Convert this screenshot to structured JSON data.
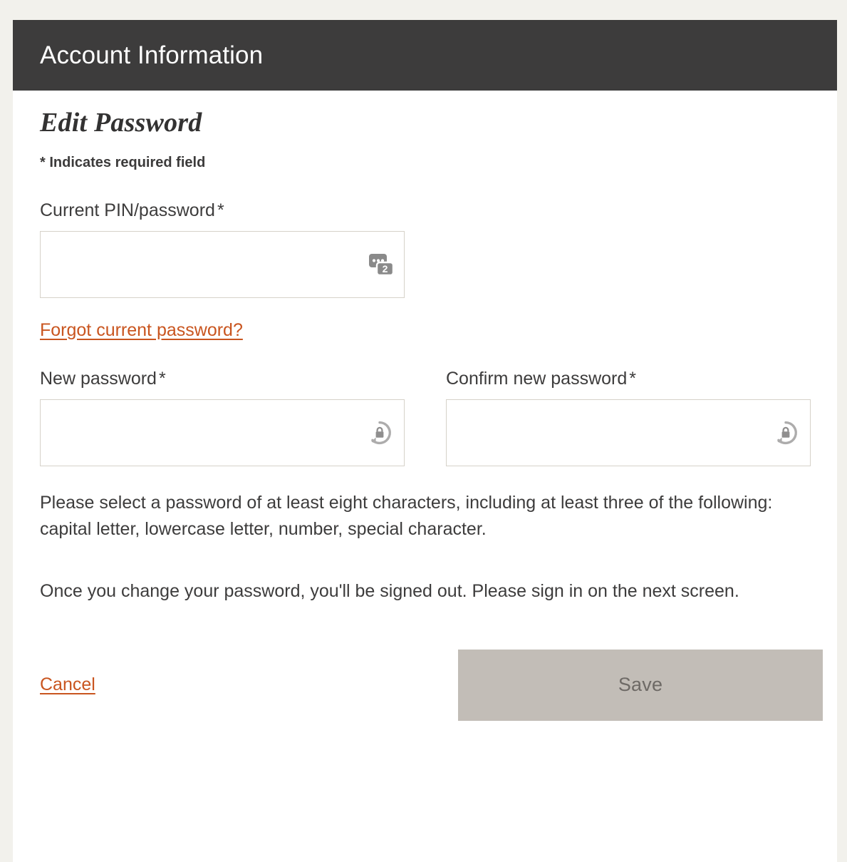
{
  "header": {
    "title": "Account Information"
  },
  "form": {
    "heading": "Edit Password",
    "required_note": "* Indicates required field",
    "required_marker": "*",
    "current_password": {
      "label": "Current PIN/password",
      "value": "",
      "placeholder": "",
      "icon": "password-manager-icon",
      "icon_badge": "2"
    },
    "forgot_link": "Forgot current password?",
    "new_password": {
      "label": "New password",
      "value": "",
      "placeholder": "",
      "icon": "generate-password-lock-icon"
    },
    "confirm_password": {
      "label": "Confirm new password",
      "value": "",
      "placeholder": "",
      "icon": "generate-password-lock-icon"
    },
    "help_text_1": "Please select a password of at least eight characters, including at least three of the following: capital letter, lowercase letter, number, special character.",
    "help_text_2": "Once you change your password, you'll be signed out. Please sign in on the next screen."
  },
  "footer": {
    "cancel_label": "Cancel",
    "save_label": "Save"
  },
  "colors": {
    "page_background": "#f2f1ec",
    "header_bar": "#3d3c3c",
    "card_background": "#ffffff",
    "link_accent": "#c9551f",
    "save_button": "#c2bdb7",
    "save_button_text": "#6e6a66",
    "input_border": "#d6d2c9",
    "body_text": "#3d3c3c",
    "icon_gray": "#8a8a8a"
  }
}
